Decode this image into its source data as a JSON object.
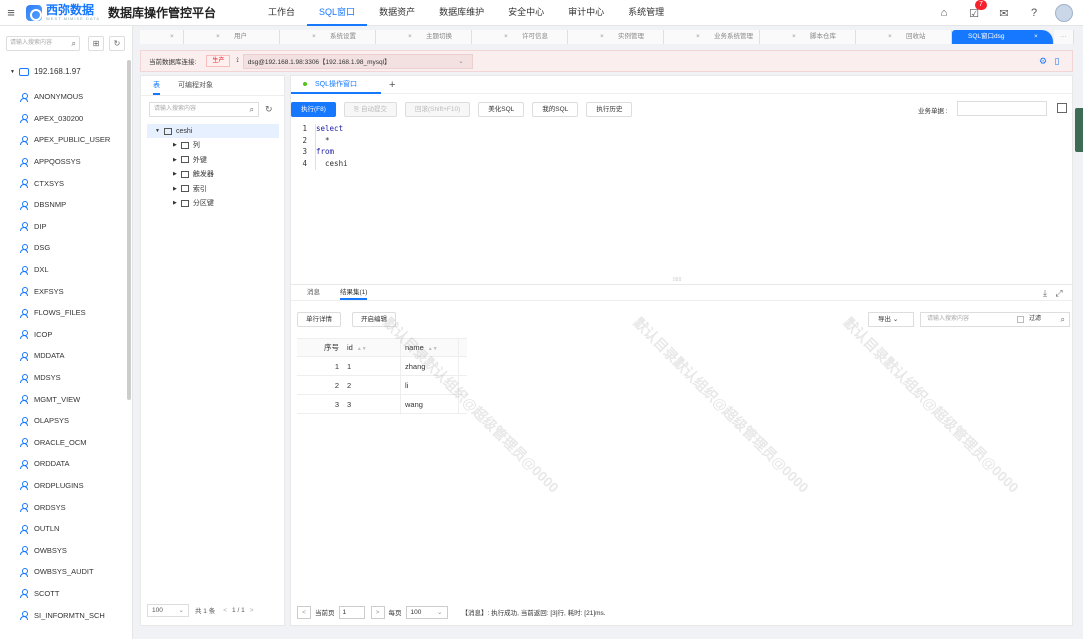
{
  "brand": {
    "name_cn": "西弥数据",
    "name_en": "WEST MIMISE DATA",
    "platform": "数据库操作管控平台"
  },
  "nav": {
    "items": [
      "工作台",
      "SQL窗口",
      "数据资产",
      "数据库维护",
      "安全中心",
      "审计中心",
      "系统管理"
    ],
    "active_index": 1
  },
  "top_icons": {
    "notify_badge": "7"
  },
  "left": {
    "search_placeholder": "请输入搜索内容",
    "root": "192.168.1.97",
    "users": [
      "ANONYMOUS",
      "APEX_030200",
      "APEX_PUBLIC_USER",
      "APPQOSSYS",
      "CTXSYS",
      "DBSNMP",
      "DIP",
      "DSG",
      "DXL",
      "EXFSYS",
      "FLOWS_FILES",
      "ICOP",
      "MDDATA",
      "MDSYS",
      "MGMT_VIEW",
      "OLAPSYS",
      "ORACLE_OCM",
      "ORDDATA",
      "ORDPLUGINS",
      "ORDSYS",
      "OUTLN",
      "OWBSYS",
      "OWBSYS_AUDIT",
      "SCOTT",
      "SI_INFORMTN_SCH"
    ]
  },
  "tabs": {
    "items": [
      "",
      "用户",
      "系统设置",
      "主题切换",
      "许可信息",
      "实例管理",
      "业务系统管理",
      "脚本仓库",
      "回收站",
      "SQL窗口dsg"
    ],
    "more": "···"
  },
  "connection": {
    "label": "当前数据库连接:",
    "env_tag": "生产",
    "value": "dsg@192.168.1.98:3306【192.168.1.98_mysql】"
  },
  "objects": {
    "tabs": [
      "表",
      "可编程对象"
    ],
    "search_placeholder": "请输入搜索内容",
    "table": "ceshi",
    "children": [
      "列",
      "外键",
      "触发器",
      "索引",
      "分区键"
    ],
    "page_size": "100",
    "total": "共 1 条",
    "pager": "1 / 1"
  },
  "editor": {
    "tab": "SQL操作窗口",
    "plus": "+",
    "buttons": {
      "run": "执行(F8)",
      "autocommit": "自动提交",
      "rollback": "回滚(Shift+F10)",
      "beautify": "美化SQL",
      "my_sql": "我的SQL",
      "history": "执行历史"
    },
    "biz_label": "业务单据 :",
    "lines": [
      "select",
      "  *",
      "from",
      "  ceshi"
    ]
  },
  "results": {
    "tabs": [
      "消息",
      "结果集(1)"
    ],
    "single_detail": "单行详情",
    "open_edit": "开启编辑",
    "export": "导出",
    "search_placeholder": "请输入搜索内容",
    "filter": "过滤",
    "columns": [
      "序号",
      "id",
      "name"
    ],
    "rows": [
      [
        "1",
        "1",
        "zhang"
      ],
      [
        "2",
        "2",
        "li"
      ],
      [
        "3",
        "3",
        "wang"
      ]
    ],
    "current_page_label": "当前页",
    "current_page": "1",
    "per_page_label": "每页",
    "per_page": "100",
    "message": "【消息】: 执行成功, 当前返回: [3]行, 耗时: [21]ms."
  },
  "watermark": "默认目录默认组织@超级管理员@0000"
}
